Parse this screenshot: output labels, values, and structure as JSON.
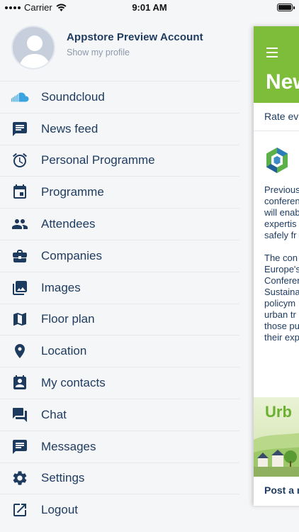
{
  "status_bar": {
    "carrier": "Carrier",
    "time": "9:01 AM"
  },
  "profile": {
    "name": "Appstore Preview Account",
    "link": "Show my profile"
  },
  "menu": {
    "items": [
      {
        "label": "Soundcloud",
        "icon": "soundcloud-icon"
      },
      {
        "label": "News feed",
        "icon": "news-feed-icon"
      },
      {
        "label": "Personal Programme",
        "icon": "alarm-clock-icon"
      },
      {
        "label": "Programme",
        "icon": "calendar-icon"
      },
      {
        "label": "Attendees",
        "icon": "people-icon"
      },
      {
        "label": "Companies",
        "icon": "briefcase-icon"
      },
      {
        "label": "Images",
        "icon": "images-icon"
      },
      {
        "label": "Floor plan",
        "icon": "map-icon"
      },
      {
        "label": "Location",
        "icon": "location-pin-icon"
      },
      {
        "label": "My contacts",
        "icon": "contacts-icon"
      },
      {
        "label": "Chat",
        "icon": "chat-icon"
      },
      {
        "label": "Messages",
        "icon": "messages-icon"
      },
      {
        "label": "Settings",
        "icon": "gear-icon"
      },
      {
        "label": "Logout",
        "icon": "logout-icon"
      }
    ]
  },
  "content_peek": {
    "title": "New",
    "rate_text": "Rate ev",
    "body_text": "Previous\nconferen\nwill enab\nexpertis\nsafely fr\n\nThe con\nEurope's\nConferen\nSustaina\npolicym\nurban tr\nthose pu\ntheir exp",
    "banner_title": "Urb",
    "post_text": "Post a n"
  },
  "colors": {
    "accent_green": "#7dbd3a",
    "text_navy": "#1d3a5f",
    "soundcloud_blue": "#3aa3e0"
  }
}
